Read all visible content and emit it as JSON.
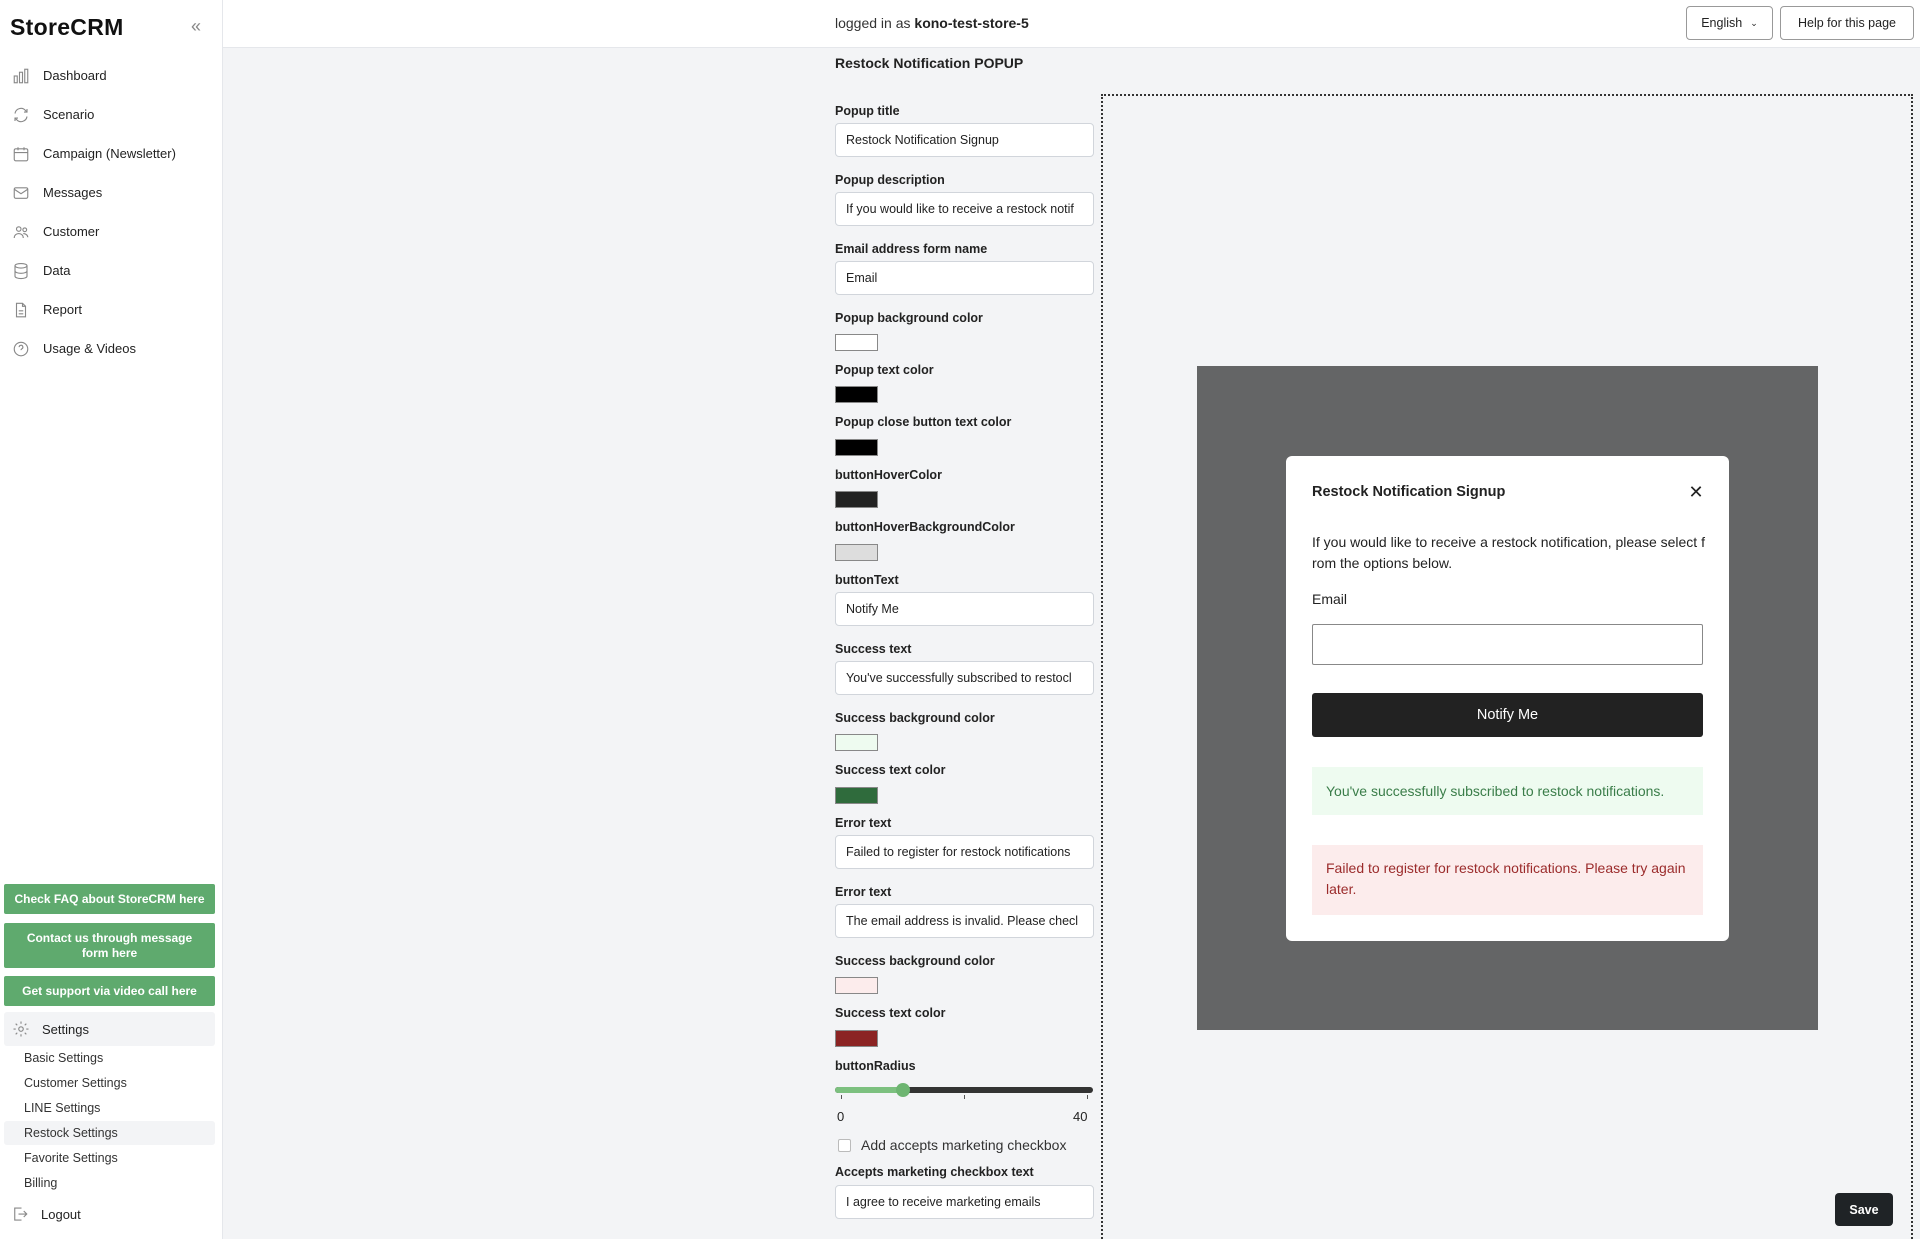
{
  "app": {
    "logo": "StoreCRM"
  },
  "sidebar": {
    "items": [
      {
        "label": "Dashboard",
        "icon": "bar-chart-icon"
      },
      {
        "label": "Scenario",
        "icon": "refresh-icon"
      },
      {
        "label": "Campaign (Newsletter)",
        "icon": "calendar-icon"
      },
      {
        "label": "Messages",
        "icon": "mail-icon"
      },
      {
        "label": "Customer",
        "icon": "users-icon"
      },
      {
        "label": "Data",
        "icon": "database-icon"
      },
      {
        "label": "Report",
        "icon": "document-icon"
      },
      {
        "label": "Usage & Videos",
        "icon": "help-circle-icon"
      }
    ],
    "faq_button": "Check FAQ about StoreCRM here",
    "contact_button": "Contact us through message form here",
    "support_button": "Get support via video call here",
    "settings_label": "Settings",
    "settings_subitems": [
      "Basic Settings",
      "Customer Settings",
      "LINE Settings",
      "Restock Settings",
      "Favorite Settings",
      "Billing"
    ],
    "active_subitem": "Restock Settings",
    "logout_label": "Logout",
    "accent_color": "#5faa6e"
  },
  "header": {
    "logged_in_prefix": "logged in as",
    "store_name": "kono-test-store-5",
    "language": "English",
    "help_button": "Help for this page"
  },
  "form": {
    "section_title": "Restock Notification POPUP",
    "popup_title_label": "Popup title",
    "popup_title_value": "Restock Notification Signup",
    "popup_description_label": "Popup description",
    "popup_description_value": "If you would like to receive a restock notif",
    "email_form_name_label": "Email address form name",
    "email_form_name_value": "Email",
    "popup_bg_color_label": "Popup background color",
    "popup_bg_color": "#ffffff",
    "popup_text_color_label": "Popup text color",
    "popup_text_color": "#000000",
    "close_btn_text_color_label": "Popup close button text color",
    "close_btn_text_color": "#000000",
    "button_hover_color_label": "buttonHoverColor",
    "button_hover_color": "#222222",
    "button_hover_bg_color_label": "buttonHoverBackgroundColor",
    "button_hover_bg_color": "#dddddd",
    "button_text_label": "buttonText",
    "button_text_value": "Notify Me",
    "success_text_label": "Success text",
    "success_text_value": "You've successfully subscribed to restocl",
    "success_bg_color_label": "Success background color",
    "success_bg_color": "#eefbf0",
    "success_text_color_label": "Success text color",
    "success_text_color": "#2f6b3c",
    "error_text_label": "Error text",
    "error_text_value": "Failed to register for restock notifications",
    "error_text2_label": "Error text",
    "error_text2_value": "The email address is invalid. Please checl",
    "error_bg_color_label": "Success background color",
    "error_bg_color": "#fcecec",
    "error_text_color_label": "Success text color",
    "error_text_color": "#8b2323",
    "button_radius_label": "buttonRadius",
    "button_radius_min": "0",
    "button_radius_max": "40",
    "button_radius_value": 10,
    "accepts_marketing_checkbox_label": "Add accepts marketing checkbox",
    "accepts_marketing_checked": false,
    "accepts_marketing_text_label": "Accepts marketing checkbox text",
    "accepts_marketing_text_value": "I agree to receive marketing emails"
  },
  "preview": {
    "title": "Restock Notification Signup",
    "close_glyph": "✕",
    "description": "If you would like to receive a restock notification, please select from the options below.",
    "email_label": "Email",
    "button_label": "Notify Me",
    "success_message": "You've successfully subscribed to restock notifications.",
    "error_message": "Failed to register for restock notifications. Please try again later."
  },
  "save_button": "Save"
}
